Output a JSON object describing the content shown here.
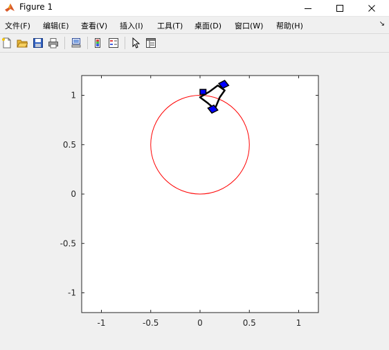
{
  "window": {
    "title": "Figure 1",
    "minimize_label": "—",
    "maximize_label": "☐",
    "close_label": "✕"
  },
  "menu": {
    "items": [
      {
        "label": "文件(F)"
      },
      {
        "label": "编辑(E)"
      },
      {
        "label": "查看(V)"
      },
      {
        "label": "插入(I)"
      },
      {
        "label": "工具(T)"
      },
      {
        "label": "桌面(D)"
      },
      {
        "label": "窗口(W)"
      },
      {
        "label": "帮助(H)"
      }
    ],
    "overflow_arrow": "↘"
  },
  "toolbar": {
    "icons": [
      "new-figure-icon",
      "open-file-icon",
      "save-icon",
      "print-icon",
      "link-plot-icon",
      "insert-colorbar-icon",
      "insert-legend-icon",
      "edit-plot-arrow-icon",
      "property-inspector-icon"
    ]
  },
  "chart_data": {
    "type": "scatter",
    "xlim": [
      -1.2,
      1.2
    ],
    "ylim": [
      -1.2,
      1.2
    ],
    "x_ticks": [
      -1,
      -0.5,
      0,
      0.5,
      1
    ],
    "y_ticks": [
      -1,
      -0.5,
      0,
      0.5,
      1
    ],
    "x_tick_labels": [
      "-1",
      "-0.5",
      "0",
      "0.5",
      "1"
    ],
    "y_tick_labels": [
      "-1",
      "-0.5",
      "0",
      "0.5",
      "1"
    ],
    "grid": false,
    "circle": {
      "cx": 0,
      "cy": 0.5,
      "r": 0.5,
      "color": "#ff0000"
    },
    "robot": {
      "body_color": "#000000",
      "wheel_color": "#0000ff",
      "body": [
        [
          0.1,
          1.04
        ],
        [
          0.18,
          1.1
        ],
        [
          0.25,
          1.05
        ],
        [
          0.2,
          0.98
        ],
        [
          0.15,
          0.86
        ],
        [
          0.08,
          0.92
        ],
        [
          0.0,
          0.98
        ],
        [
          0.1,
          1.04
        ]
      ],
      "wheels": [
        [
          [
            0.19,
            1.12
          ],
          [
            0.25,
            1.15
          ],
          [
            0.29,
            1.1
          ],
          [
            0.23,
            1.07
          ]
        ],
        [
          [
            0.08,
            0.87
          ],
          [
            0.14,
            0.9
          ],
          [
            0.18,
            0.85
          ],
          [
            0.12,
            0.82
          ]
        ],
        [
          [
            0.0,
            1.06
          ],
          [
            0.06,
            1.06
          ],
          [
            0.06,
            1.01
          ],
          [
            0.0,
            1.01
          ]
        ]
      ]
    }
  }
}
